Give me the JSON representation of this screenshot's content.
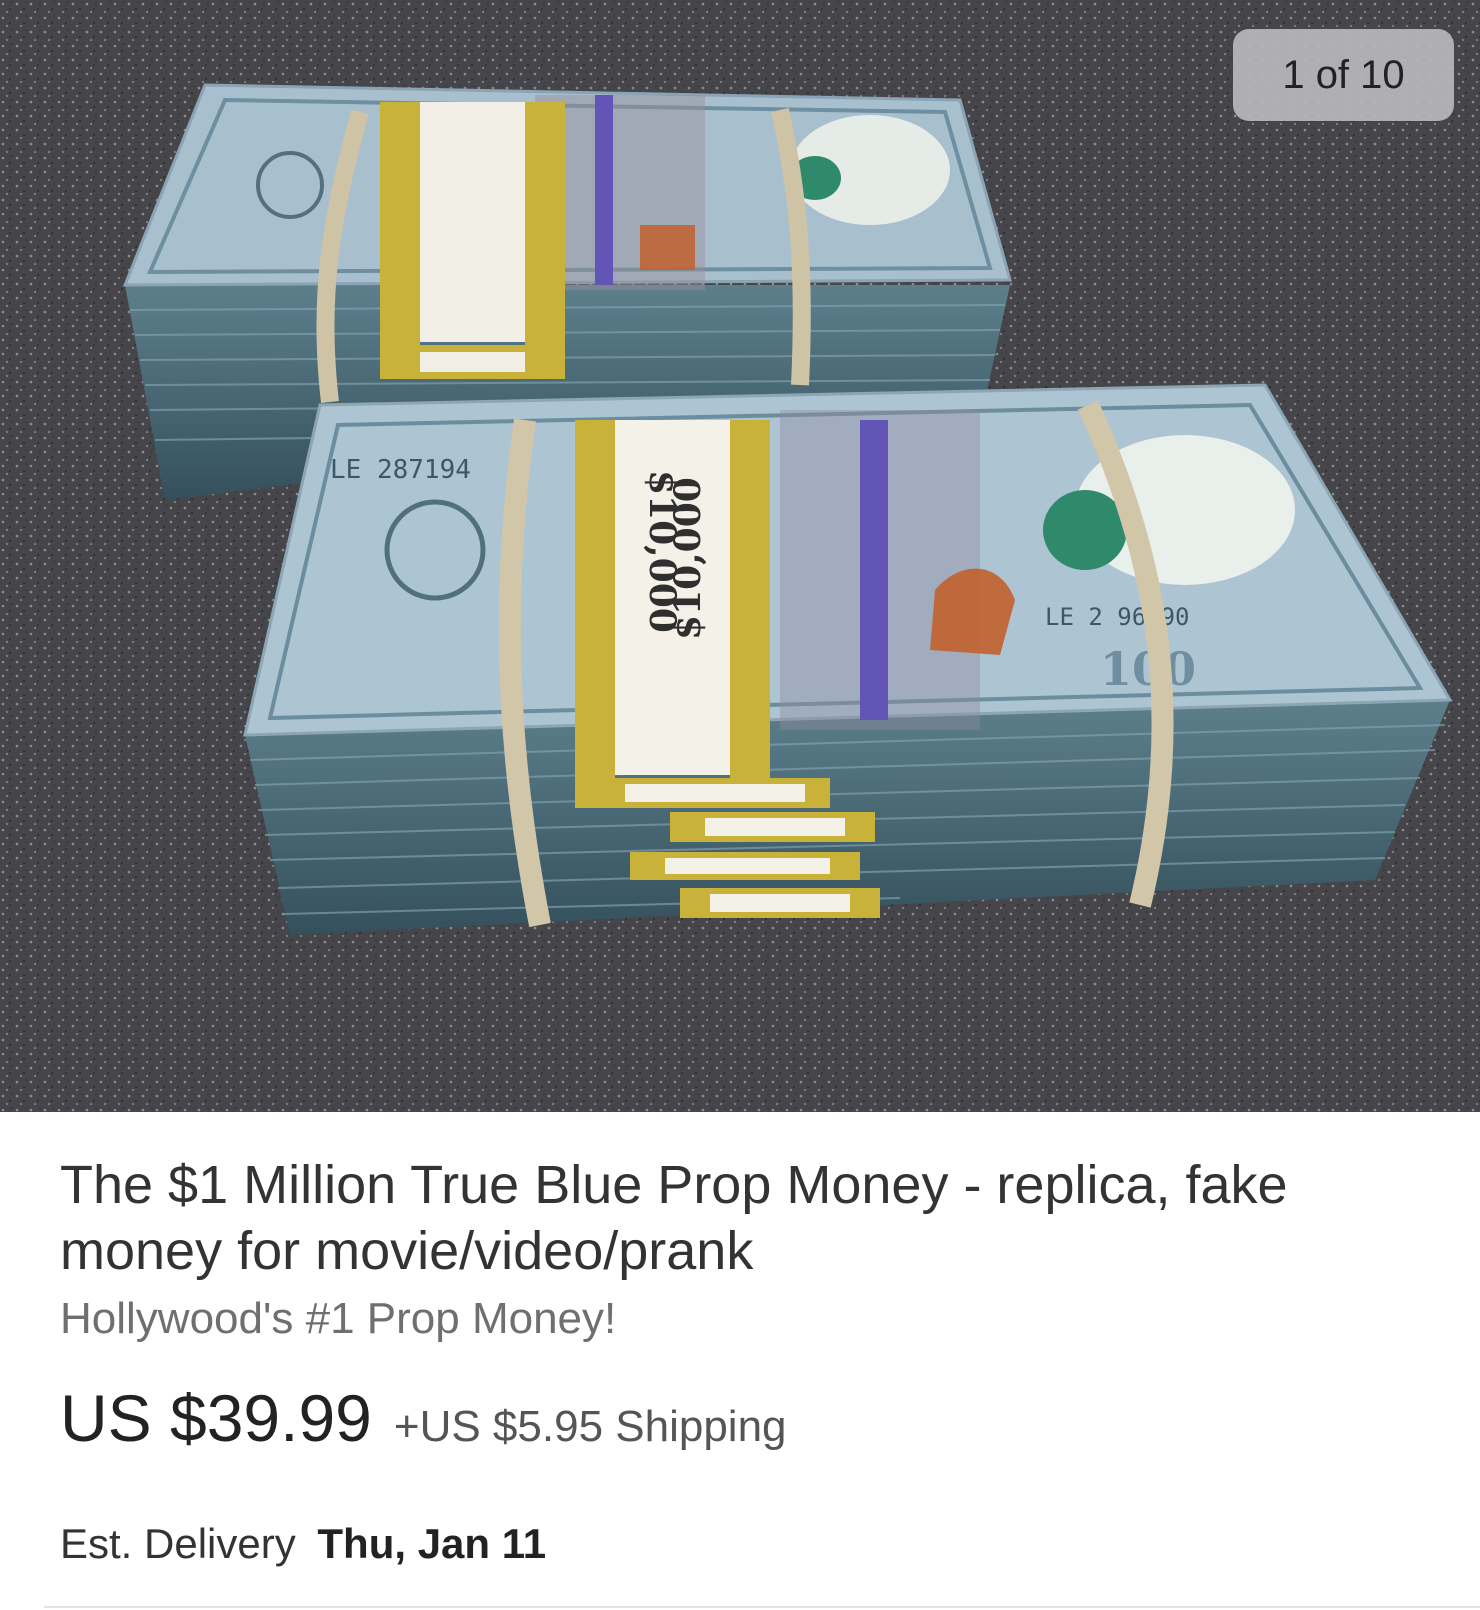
{
  "gallery": {
    "counter_label": "1 of 10",
    "photo_subject": "two banded stacks of blue prop $100 bills on a granite countertop",
    "band_label": "$10,000"
  },
  "listing": {
    "title": "The $1 Million True Blue Prop Money - replica, fake money for movie/video/prank",
    "subtitle": "Hollywood's #1 Prop Money!",
    "price": "US $39.99",
    "shipping": "+US $5.95 Shipping",
    "delivery_label": "Est. Delivery",
    "delivery_date": "Thu, Jan 11"
  },
  "colors": {
    "bill_blue": "#9fb7c8",
    "stack_edge": "#4c6a78",
    "band_yellow": "#c9b23a",
    "counter_bg": "#b9b9bc"
  }
}
